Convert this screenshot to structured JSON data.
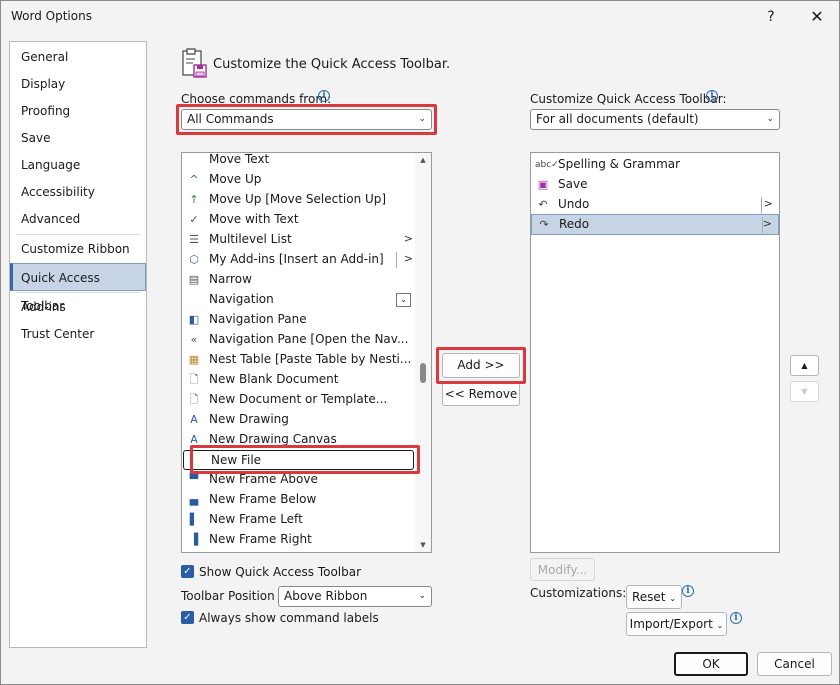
{
  "window": {
    "title": "Word Options",
    "help_label": "?",
    "close_label": "✕"
  },
  "nav": {
    "items": [
      {
        "label": "General"
      },
      {
        "label": "Display"
      },
      {
        "label": "Proofing"
      },
      {
        "label": "Save"
      },
      {
        "label": "Language"
      },
      {
        "label": "Accessibility"
      },
      {
        "label": "Advanced"
      },
      {
        "label": "Customize Ribbon"
      },
      {
        "label": "Quick Access Toolbar",
        "selected": true
      },
      {
        "label": "Add-ins"
      },
      {
        "label": "Trust Center"
      }
    ]
  },
  "header": {
    "title": "Customize the Quick Access Toolbar."
  },
  "commands": {
    "label": "Choose commands from:",
    "selected": "All Commands",
    "items": [
      {
        "label": "Move Text",
        "icon": "none"
      },
      {
        "label": "Move Up",
        "icon": "caret-up-icon"
      },
      {
        "label": "Move Up [Move Selection Up]",
        "icon": "arrow-up-icon"
      },
      {
        "label": "Move with Text",
        "icon": "check-icon"
      },
      {
        "label": "Multilevel List",
        "icon": "multilevel-list-icon",
        "submenu": ">"
      },
      {
        "label": "My Add-ins [Insert an Add-in]",
        "icon": "addins-icon",
        "submenu": ">"
      },
      {
        "label": "Narrow",
        "icon": "narrow-icon"
      },
      {
        "label": "Navigation",
        "icon": "none",
        "dropdown": true
      },
      {
        "label": "Navigation Pane",
        "icon": "navigation-pane-icon"
      },
      {
        "label": "Navigation Pane [Open the Nav...",
        "icon": "chevrons-left-icon"
      },
      {
        "label": "Nest Table [Paste Table by Nesti...",
        "icon": "nest-table-icon"
      },
      {
        "label": "New Blank Document",
        "icon": "document-icon"
      },
      {
        "label": "New Document or Template...",
        "icon": "document-icon"
      },
      {
        "label": "New Drawing",
        "icon": "drawing-icon"
      },
      {
        "label": "New Drawing Canvas",
        "icon": "drawing-icon"
      },
      {
        "label": "New File",
        "icon": "none",
        "focused": true
      },
      {
        "label": "New Frame Above",
        "icon": "frame-above-icon"
      },
      {
        "label": "New Frame Below",
        "icon": "frame-below-icon"
      },
      {
        "label": "New Frame Left",
        "icon": "frame-left-icon"
      },
      {
        "label": "New Frame Right",
        "icon": "frame-right-icon"
      }
    ]
  },
  "toolbar": {
    "label": "Customize Quick Access Toolbar:",
    "selected": "For all documents (default)",
    "items": [
      {
        "label": "Spelling & Grammar",
        "icon": "spelling-icon"
      },
      {
        "label": "Save",
        "icon": "save-icon"
      },
      {
        "label": "Undo",
        "icon": "undo-icon",
        "submenu": ">"
      },
      {
        "label": "Redo",
        "icon": "redo-icon",
        "submenu": ">",
        "selected": true
      }
    ]
  },
  "buttons": {
    "add": "Add >>",
    "remove": "<< Remove",
    "modify": "Modify...",
    "reset": "Reset",
    "import_export": "Import/Export",
    "ok": "OK",
    "cancel": "Cancel",
    "move_up": "▲",
    "move_down": "▼"
  },
  "options": {
    "show_toolbar": "Show Quick Access Toolbar",
    "toolbar_position_label": "Toolbar Position",
    "toolbar_position_value": "Above Ribbon",
    "always_show_labels": "Always show command labels",
    "customizations_label": "Customizations:"
  },
  "colors": {
    "accent": "#2b5da7",
    "highlight": "#d9393f",
    "selection": "#c6d4e6"
  }
}
